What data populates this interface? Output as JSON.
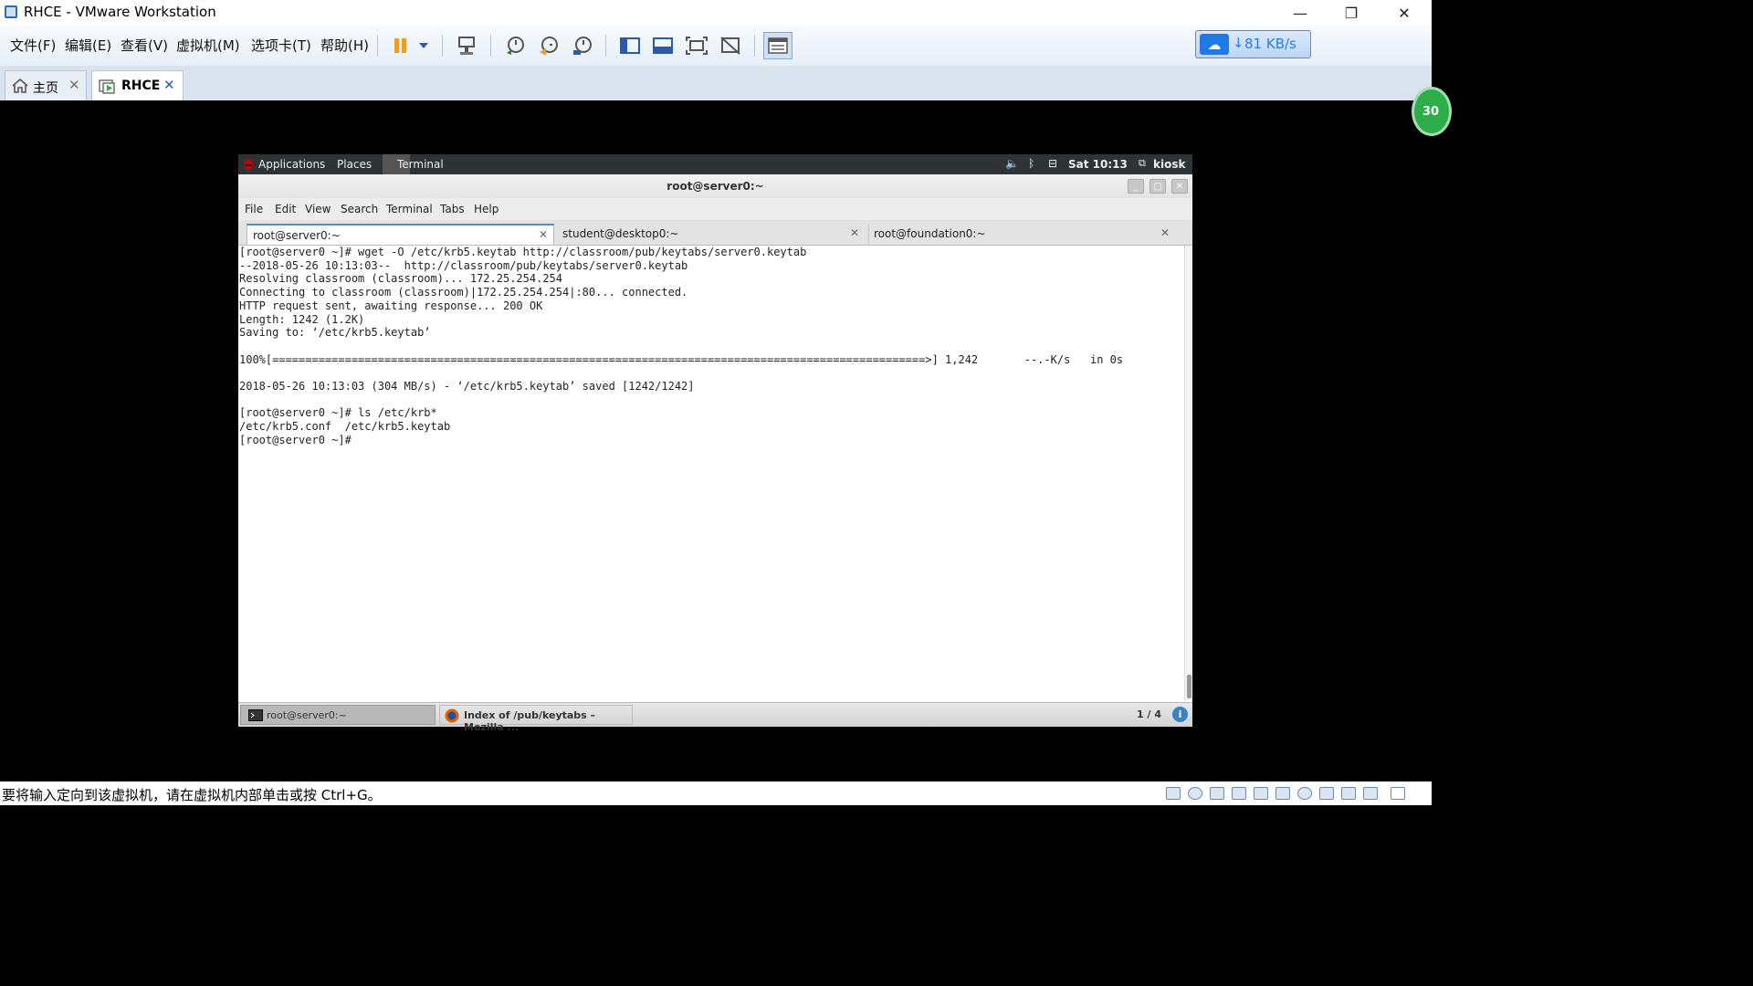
{
  "window": {
    "title": "RHCE - VMware Workstation",
    "controls": {
      "minimize": "—",
      "restore": "❐",
      "close": "✕"
    }
  },
  "menu": [
    "文件(F)",
    "编辑(E)",
    "查看(V)",
    "虚拟机(M)",
    "选项卡(T)",
    "帮助(H)"
  ],
  "toolbar": {
    "icons": [
      "pause-icon",
      "dropdown-icon",
      "send-ctrl-alt-del-icon",
      "snapshot-icon",
      "revert-snapshot-icon",
      "snapshot-manager-icon",
      "console-view-icon",
      "thumbnail-view-icon",
      "fullscreen-icon",
      "unity-icon",
      "library-icon"
    ],
    "speed_label": "81 KB/s"
  },
  "tabs": [
    {
      "label": "主页",
      "close": "✕"
    },
    {
      "label": "RHCE",
      "close": "✕"
    }
  ],
  "badge": "30",
  "guest": {
    "topbar": {
      "applications": "Applications",
      "places": "Places",
      "terminal": "Terminal",
      "clock": "Sat 10:13",
      "user": "kiosk"
    },
    "window_title": "root@server0:~",
    "menu": [
      "File",
      "Edit",
      "View",
      "Search",
      "Terminal",
      "Tabs",
      "Help"
    ],
    "tabs": [
      {
        "label": "root@server0:~",
        "close": "✕"
      },
      {
        "label": "student@desktop0:~",
        "close": "✕"
      },
      {
        "label": "root@foundation0:~",
        "close": "✕"
      }
    ],
    "terminal_lines": [
      "[root@server0 ~]# wget -O /etc/krb5.keytab http://classroom/pub/keytabs/server0.keytab",
      "--2018-05-26 10:13:03--  http://classroom/pub/keytabs/server0.keytab",
      "Resolving classroom (classroom)... 172.25.254.254",
      "Connecting to classroom (classroom)|172.25.254.254|:80... connected.",
      "HTTP request sent, awaiting response... 200 OK",
      "Length: 1242 (1.2K)",
      "Saving to: ‘/etc/krb5.keytab’",
      "",
      "100%[===================================================================================================>] 1,242       --.-K/s   in 0s",
      "",
      "2018-05-26 10:13:03 (304 MB/s) - ‘/etc/krb5.keytab’ saved [1242/1242]",
      "",
      "[root@server0 ~]# ls /etc/krb*",
      "/etc/krb5.conf  /etc/krb5.keytab",
      "[root@server0 ~]#"
    ],
    "taskbar": {
      "items": [
        "root@server0:~",
        "Index of /pub/keytabs – Mozilla ..."
      ],
      "workspace": "1 / 4",
      "info": "i"
    }
  },
  "status": {
    "message": "要将输入定向到该虚拟机，请在虚拟机内部单击或按 Ctrl+G。"
  }
}
